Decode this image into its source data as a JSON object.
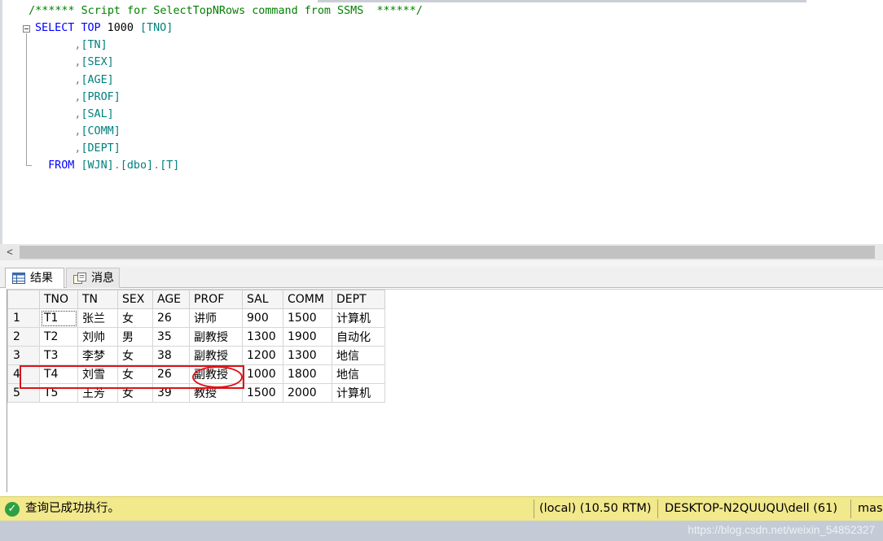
{
  "editor": {
    "lines": [
      {
        "parts": [
          {
            "c": "cm",
            "t": "  /****** Script for SelectTopNRows command from SSMS  ******/"
          }
        ]
      },
      {
        "parts": [
          {
            "c": "kw",
            "t": "SELECT"
          },
          {
            "c": "",
            "t": " "
          },
          {
            "c": "kw",
            "t": "TOP"
          },
          {
            "c": "",
            "t": " 1000 "
          },
          {
            "c": "id",
            "t": "[TNO]"
          }
        ]
      },
      {
        "parts": [
          {
            "c": "",
            "t": "      "
          },
          {
            "c": "gr",
            "t": ","
          },
          {
            "c": "id",
            "t": "[TN]"
          }
        ]
      },
      {
        "parts": [
          {
            "c": "",
            "t": "      "
          },
          {
            "c": "gr",
            "t": ","
          },
          {
            "c": "id",
            "t": "[SEX]"
          }
        ]
      },
      {
        "parts": [
          {
            "c": "",
            "t": "      "
          },
          {
            "c": "gr",
            "t": ","
          },
          {
            "c": "id",
            "t": "[AGE]"
          }
        ]
      },
      {
        "parts": [
          {
            "c": "",
            "t": "      "
          },
          {
            "c": "gr",
            "t": ","
          },
          {
            "c": "id",
            "t": "[PROF]"
          }
        ]
      },
      {
        "parts": [
          {
            "c": "",
            "t": "      "
          },
          {
            "c": "gr",
            "t": ","
          },
          {
            "c": "id",
            "t": "[SAL]"
          }
        ]
      },
      {
        "parts": [
          {
            "c": "",
            "t": "      "
          },
          {
            "c": "gr",
            "t": ","
          },
          {
            "c": "id",
            "t": "[COMM]"
          }
        ]
      },
      {
        "parts": [
          {
            "c": "",
            "t": "      "
          },
          {
            "c": "gr",
            "t": ","
          },
          {
            "c": "id",
            "t": "[DEPT]"
          }
        ]
      },
      {
        "parts": [
          {
            "c": "",
            "t": "  "
          },
          {
            "c": "kw",
            "t": "FROM"
          },
          {
            "c": "",
            "t": " "
          },
          {
            "c": "id",
            "t": "[WJN]"
          },
          {
            "c": "gr",
            "t": "."
          },
          {
            "c": "id",
            "t": "[dbo]"
          },
          {
            "c": "gr",
            "t": "."
          },
          {
            "c": "id",
            "t": "[T]"
          }
        ]
      }
    ]
  },
  "scrollbar": {
    "left_arrow": "<"
  },
  "tabs": {
    "results": "结果",
    "messages": "消息"
  },
  "results": {
    "columns": [
      "TNO",
      "TN",
      "SEX",
      "AGE",
      "PROF",
      "SAL",
      "COMM",
      "DEPT"
    ],
    "rows": [
      [
        "1",
        "T1",
        "张兰",
        "女",
        "26",
        "讲师",
        "900",
        "1500",
        "计算机"
      ],
      [
        "2",
        "T2",
        "刘帅",
        "男",
        "35",
        "副教授",
        "1300",
        "1900",
        "自动化"
      ],
      [
        "3",
        "T3",
        "李梦",
        "女",
        "38",
        "副教授",
        "1200",
        "1300",
        "地信"
      ],
      [
        "4",
        "T4",
        "刘雪",
        "女",
        "26",
        "副教授",
        "1000",
        "1800",
        "地信"
      ],
      [
        "5",
        "T5",
        "王芳",
        "女",
        "39",
        "教授",
        "1500",
        "2000",
        "计算机"
      ]
    ]
  },
  "status": {
    "message": "查询已成功执行。",
    "server": "(local) (10.50 RTM)",
    "user": "DESKTOP-N2QUUQU\\dell (61)",
    "db": "mas"
  },
  "watermark": "https://blog.csdn.net/weixin_54852327"
}
